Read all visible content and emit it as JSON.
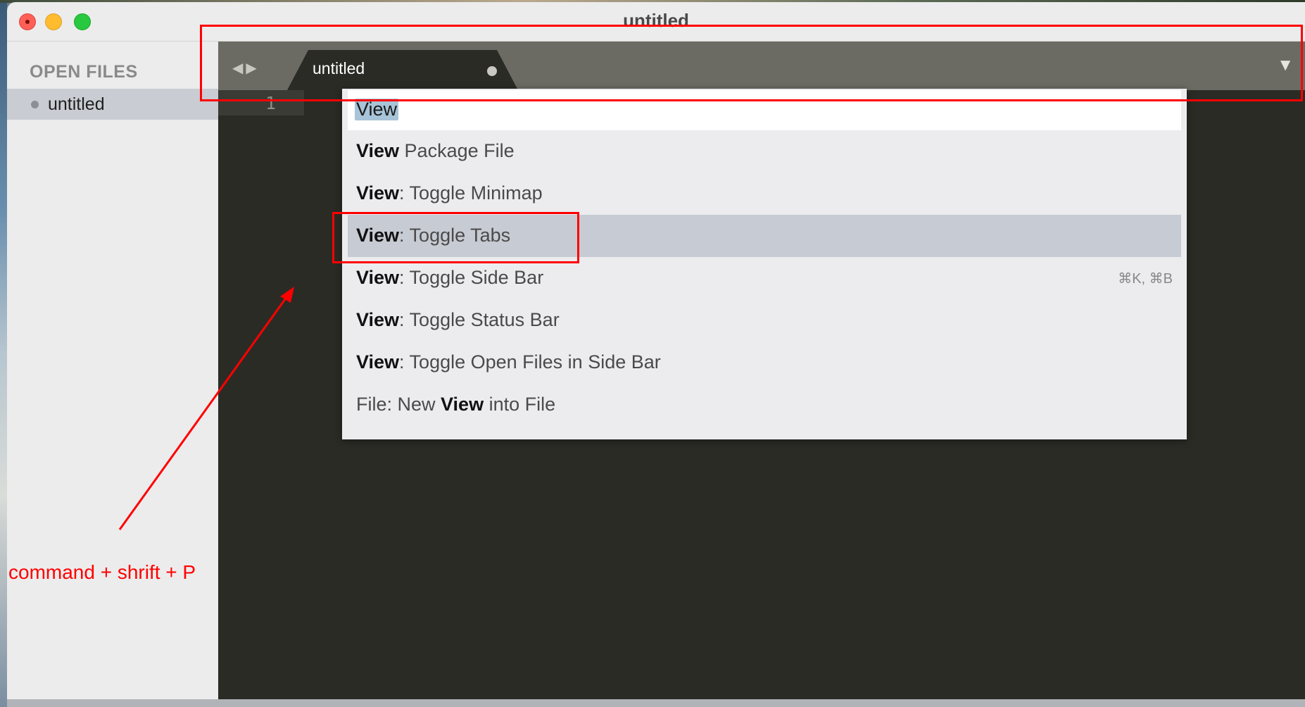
{
  "window": {
    "title": "untitled"
  },
  "sidebar": {
    "heading": "OPEN FILES",
    "items": [
      {
        "label": "untitled"
      }
    ]
  },
  "tabbar": {
    "nav_back_icon": "◀",
    "nav_forward_icon": "▶",
    "tab_label": "untitled",
    "menu_icon": "▼"
  },
  "editor": {
    "line_number": "1"
  },
  "palette": {
    "query": "View",
    "items": [
      {
        "bold": "View",
        "rest": " Package File",
        "shortcut": ""
      },
      {
        "bold": "View",
        "rest": ": Toggle Minimap",
        "shortcut": ""
      },
      {
        "bold": "View",
        "rest": ": Toggle Tabs",
        "shortcut": ""
      },
      {
        "bold": "View",
        "rest": ": Toggle Side Bar",
        "shortcut": "⌘K, ⌘B"
      },
      {
        "bold": "View",
        "rest": ": Toggle Status Bar",
        "shortcut": ""
      },
      {
        "bold": "View",
        "rest": ": Toggle Open Files in Side Bar",
        "shortcut": ""
      }
    ],
    "last_item": {
      "prefix": "File: New ",
      "bold": "View",
      "suffix": " into File"
    }
  },
  "annotation": {
    "text": "command + shrift + P",
    "color": "#ff0000"
  },
  "colors": {
    "editor_bg": "#2a2b25",
    "tabbar_bg": "#6b6b63",
    "sidebar_bg": "#ececec",
    "selection": "#c7cbd3"
  }
}
